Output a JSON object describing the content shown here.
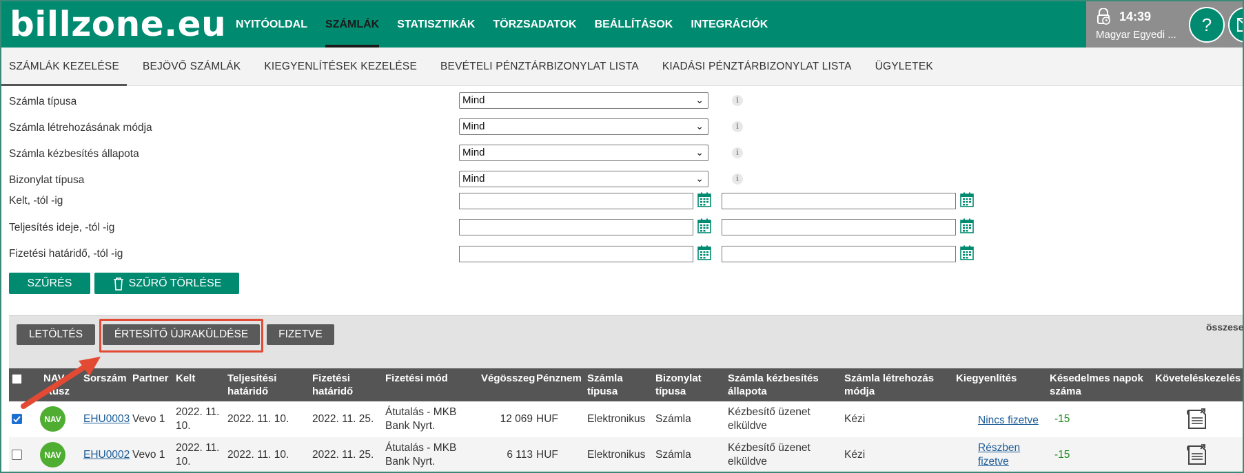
{
  "header": {
    "logo": "billzone.eu",
    "nav": [
      "NYITÓOLDAL",
      "SZÁMLÁK",
      "STATISZTIKÁK",
      "TÖRZSADATOK",
      "BEÁLLÍTÁSOK",
      "INTEGRÁCIÓK"
    ],
    "active_nav": "SZÁMLÁK",
    "time": "14:39",
    "user": "Magyar Egyedi ...",
    "help": "?",
    "accent": "#008a70"
  },
  "subnav": [
    "SZÁMLÁK KEZELÉSE",
    "BEJÖVŐ SZÁMLÁK",
    "KIEGYENLÍTÉSEK KEZELÉSE",
    "BEVÉTELI PÉNZTÁRBIZONYLAT LISTA",
    "KIADÁSI PÉNZTÁRBIZONYLAT LISTA",
    "ÜGYLETEK"
  ],
  "filters": {
    "selects": [
      {
        "label": "Számla típusa",
        "value": "Mind"
      },
      {
        "label": "Számla létrehozásának módja",
        "value": "Mind"
      },
      {
        "label": "Számla kézbesítés állapota",
        "value": "Mind"
      },
      {
        "label": "Bizonylat típusa",
        "value": "Mind"
      }
    ],
    "info": "i",
    "dates": [
      "Kelt, -tól -ig",
      "Teljesítés ideje, -tól -ig",
      "Fizetési határidő, -tól -ig"
    ],
    "filter_button": "SZŰRÉS",
    "clear_button": "SZŰRŐ TÖRLÉSE"
  },
  "actions": {
    "download": "LETÖLTÉS",
    "resend": "ÉRTESÍTŐ ÚJRAKÜLDÉSE",
    "paid": "FIZETVE",
    "total_label": "összese"
  },
  "table": {
    "headers": {
      "nav": "NAV",
      "statusz": "tusz",
      "sorszam": "Sorszám",
      "partner": "Partner",
      "kelt": "Kelt",
      "telj_1": "Teljesítési",
      "telj_2": "határidő",
      "fiz_1": "Fizetési",
      "fiz_2": "határidő",
      "fizmod": "Fizetési mód",
      "vegosszeg": "Végösszeg",
      "penznem": "Pénznem",
      "sztip_1": "Számla",
      "sztip_2": "típusa",
      "biz_1": "Bizonylat",
      "biz_2": "típusa",
      "kezb_1": "Számla kézbesítés",
      "kezb_2": "állapota",
      "letr_1": "Számla létrehozás",
      "letr_2": "módja",
      "kiegy": "Kiegyenlítés",
      "kes_1": "Késedelmes napok",
      "kes_2": "száma",
      "kovet": "Követeléskezelés"
    },
    "rows": [
      {
        "checked": true,
        "nav": "NAV",
        "sorszam": "EHU0003",
        "partner": "Vevo 1",
        "kelt_1": "2022. 11.",
        "kelt_2": "10.",
        "teljesites": "2022. 11. 10.",
        "hatarido": "2022. 11. 25.",
        "fizmod_1": "Átutalás - MKB",
        "fizmod_2": "Bank Nyrt.",
        "vegosszeg": "12 069",
        "penznem": "HUF",
        "tipus": "Elektronikus",
        "bizonylat": "Számla",
        "kezb_1": "Kézbesítő üzenet",
        "kezb_2": "elküldve",
        "letrehozas": "Kézi",
        "kiegy_1": "Nincs fizetve",
        "kiegy_2": "",
        "kesedelem": "-15"
      },
      {
        "checked": false,
        "nav": "NAV",
        "sorszam": "EHU0002",
        "partner": "Vevo 1",
        "kelt_1": "2022. 11.",
        "kelt_2": "10.",
        "teljesites": "2022. 11. 10.",
        "hatarido": "2022. 11. 25.",
        "fizmod_1": "Átutalás - MKB",
        "fizmod_2": "Bank Nyrt.",
        "vegosszeg": "6 113",
        "penznem": "HUF",
        "tipus": "Elektronikus",
        "bizonylat": "Számla",
        "kezb_1": "Kézbesítő üzenet",
        "kezb_2": "elküldve",
        "letrehozas": "Kézi",
        "kiegy_1": "Részben",
        "kiegy_2": "fizetve",
        "kesedelem": "-15"
      }
    ]
  }
}
